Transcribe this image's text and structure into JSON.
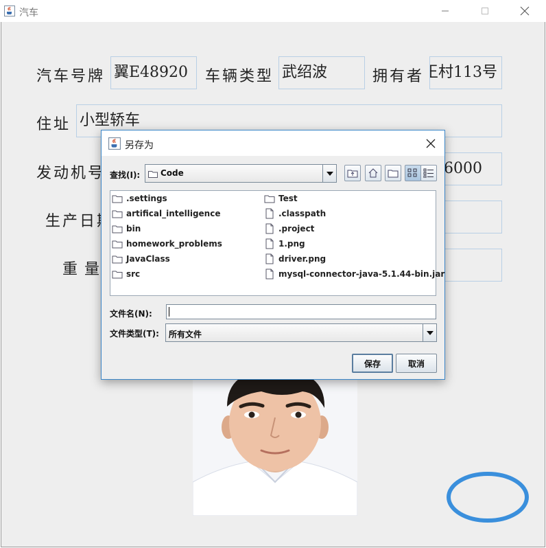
{
  "window": {
    "title": "汽车"
  },
  "form": {
    "plate_label": "汽车号牌",
    "plate_value": "翼E48920",
    "type_label": "车辆类型",
    "type_value": "武绍波",
    "owner_label": "拥有者",
    "owner_value": "王村113号",
    "address_label": "住址",
    "address_value": "小型轿车",
    "engine_label": "发动机号",
    "engine_value": "6000",
    "date_label": "生产日期",
    "weight_label": "重量"
  },
  "dialog": {
    "title": "另存为",
    "look_in_label": "查找(I):",
    "look_in_value": "Code",
    "files_col1": [
      {
        "name": ".settings",
        "kind": "folder"
      },
      {
        "name": "artifical_intelligence",
        "kind": "folder"
      },
      {
        "name": "bin",
        "kind": "folder"
      },
      {
        "name": "homework_problems",
        "kind": "folder"
      },
      {
        "name": "JavaClass",
        "kind": "folder"
      },
      {
        "name": "src",
        "kind": "folder"
      }
    ],
    "files_col2": [
      {
        "name": "Test",
        "kind": "folder"
      },
      {
        "name": ".classpath",
        "kind": "file"
      },
      {
        "name": ".project",
        "kind": "file"
      },
      {
        "name": "1.png",
        "kind": "file"
      },
      {
        "name": "driver.png",
        "kind": "file"
      },
      {
        "name": "mysql-connector-java-5.1.44-bin.jar",
        "kind": "file"
      }
    ],
    "file_name_label": "文件名(N):",
    "file_name_value": "",
    "file_type_label": "文件类型(T):",
    "file_type_value": "所有文件",
    "save_label": "保存",
    "cancel_label": "取消"
  },
  "colors": {
    "accent": "#3b86c8",
    "ring": "#3a8fdc",
    "window_bg": "#eeeeee"
  }
}
